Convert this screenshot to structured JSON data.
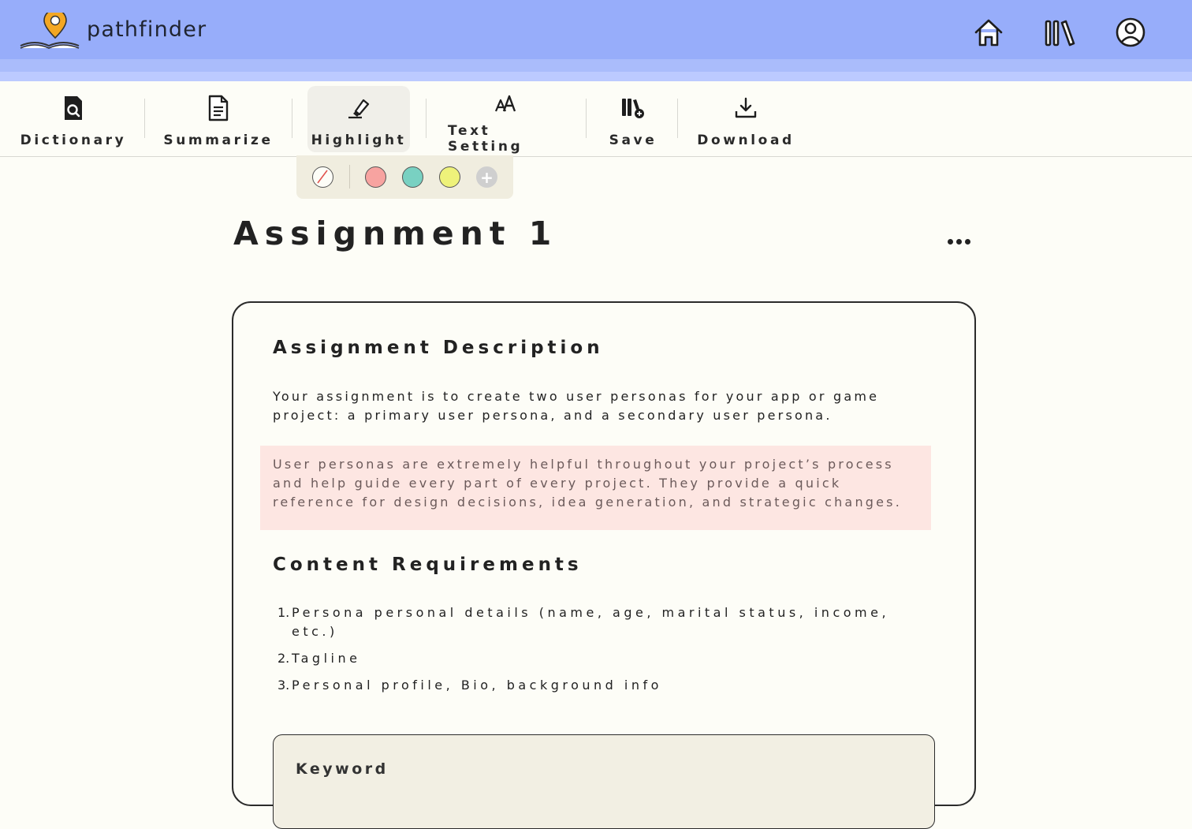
{
  "app": {
    "name": "pathfinder"
  },
  "topbar": {
    "icons": [
      "home-icon",
      "library-icon",
      "user-profile-icon"
    ],
    "bg_color": "#97adfa"
  },
  "toolbar": {
    "items": [
      {
        "label": "Dictionary",
        "icon": "dictionary-search-icon"
      },
      {
        "label": "Summarize",
        "icon": "document-icon"
      },
      {
        "label": "Highlight",
        "icon": "highlighter-icon",
        "active": true
      },
      {
        "label": "Text Setting",
        "icon": "text-size-icon"
      },
      {
        "label": "Save",
        "icon": "save-library-icon"
      },
      {
        "label": "Download",
        "icon": "download-icon"
      }
    ]
  },
  "highlight_palette": {
    "colors": [
      {
        "name": "none",
        "hex": "#fdfdf7"
      },
      {
        "name": "pink",
        "hex": "#f7a3a0"
      },
      {
        "name": "teal",
        "hex": "#79d1c2"
      },
      {
        "name": "yellow",
        "hex": "#eef27a"
      },
      {
        "name": "add",
        "hex": "#cfcfcf"
      }
    ]
  },
  "page": {
    "title": "Assignment 1"
  },
  "assignment": {
    "description_heading": "Assignment Description",
    "description_text": "Your assignment is to create two user personas for your app or game project: a primary user persona, and a secondary user persona.",
    "highlighted_text": "User personas are extremely helpful throughout your project’s process and help guide every part of every project. They provide a quick reference for design decisions, idea generation, and strategic changes.",
    "highlight_color": "#fde6e2",
    "requirements_heading": "Content Requirements",
    "requirements": [
      {
        "num": "1.",
        "text": "Persona personal details (name, age, marital status, income, etc.)"
      },
      {
        "num": "2.",
        "text": "Tagline"
      },
      {
        "num": "3.",
        "text": "Personal profile, Bio, background info"
      }
    ],
    "keyword_heading": "Keyword"
  }
}
